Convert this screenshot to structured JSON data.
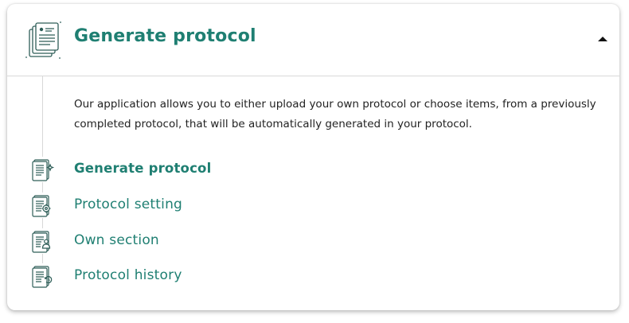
{
  "panel": {
    "title": "Generate protocol",
    "header_icon": "documents-stack-icon",
    "collapse_icon": "caret-up-icon",
    "expanded": true,
    "description": "Our application allows you to either upload your own protocol or choose items, from a previously completed protocol, that will be automatically generated in your protocol."
  },
  "steps": [
    {
      "label": "Generate protocol",
      "icon": "document-sparkle-icon",
      "active": true
    },
    {
      "label": "Protocol setting",
      "icon": "document-gear-icon",
      "active": false
    },
    {
      "label": "Own section",
      "icon": "document-user-icon",
      "active": false
    },
    {
      "label": "Protocol history",
      "icon": "document-history-icon",
      "active": false
    }
  ],
  "colors": {
    "accent": "#1f7f72",
    "text": "#222222",
    "icon_stroke": "#2e5e58",
    "divider": "#d9d9d9"
  }
}
